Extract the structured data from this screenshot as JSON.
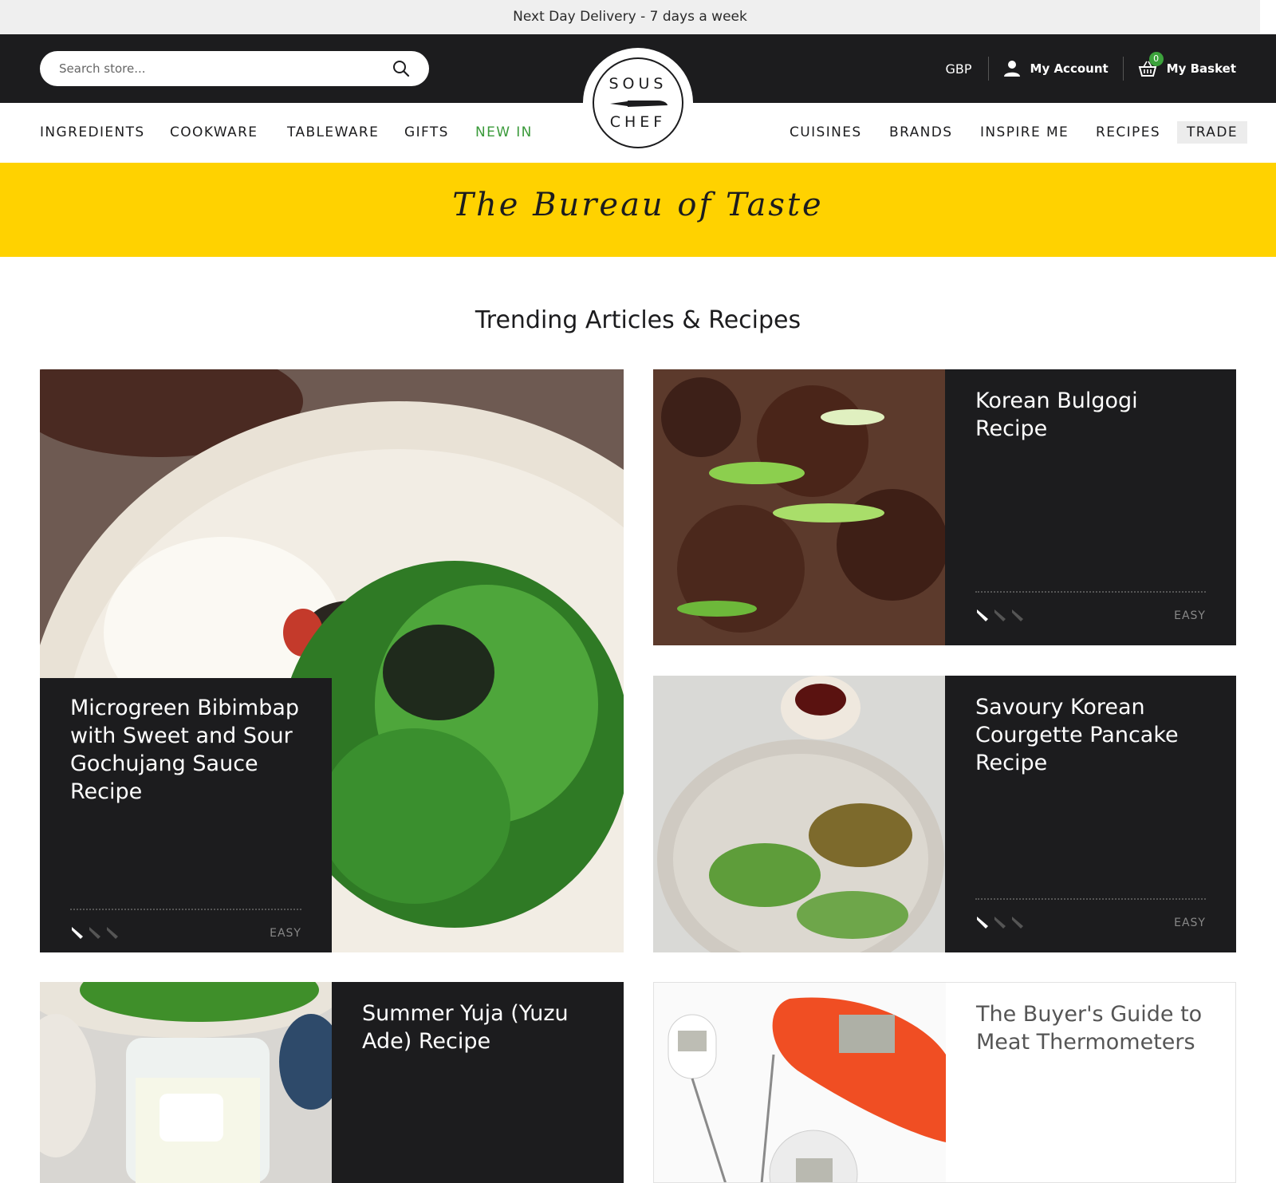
{
  "topbar": {
    "text": "Next Day Delivery - 7 days a week"
  },
  "header": {
    "search_placeholder": "Search store...",
    "currency": "GBP",
    "account_label": "My Account",
    "basket_label": "My Basket",
    "basket_count": "0"
  },
  "logo": {
    "line1": "SOUS",
    "line2": "CHEF"
  },
  "nav": {
    "left": [
      "INGREDIENTS",
      "COOKWARE",
      "TABLEWARE",
      "GIFTS",
      "NEW IN"
    ],
    "right": [
      "CUISINES",
      "BRANDS",
      "INSPIRE ME",
      "RECIPES",
      "TRADE"
    ]
  },
  "banner": {
    "title": "The Bureau of Taste"
  },
  "section": {
    "title": "Trending Articles & Recipes"
  },
  "cards": [
    {
      "title": "Microgreen Bibimbap with Sweet and Sour Gochujang Sauce Recipe",
      "difficulty": "EASY",
      "difficulty_level": 1,
      "difficulty_max": 3
    },
    {
      "title": "Korean Bulgogi Recipe",
      "difficulty": "EASY",
      "difficulty_level": 1,
      "difficulty_max": 3
    },
    {
      "title": "Savoury Korean Courgette Pancake Recipe",
      "difficulty": "EASY",
      "difficulty_level": 1,
      "difficulty_max": 3
    },
    {
      "title": "Summer Yuja (Yuzu Ade) Recipe"
    },
    {
      "title": "The Buyer's Guide to Meat Thermometers"
    }
  ],
  "colors": {
    "accent_yellow": "#ffd200",
    "dark": "#1c1c1e",
    "new_in_green": "#3a9a3a",
    "badge_green": "#3ca23c",
    "thermometer_orange": "#f04e23"
  }
}
